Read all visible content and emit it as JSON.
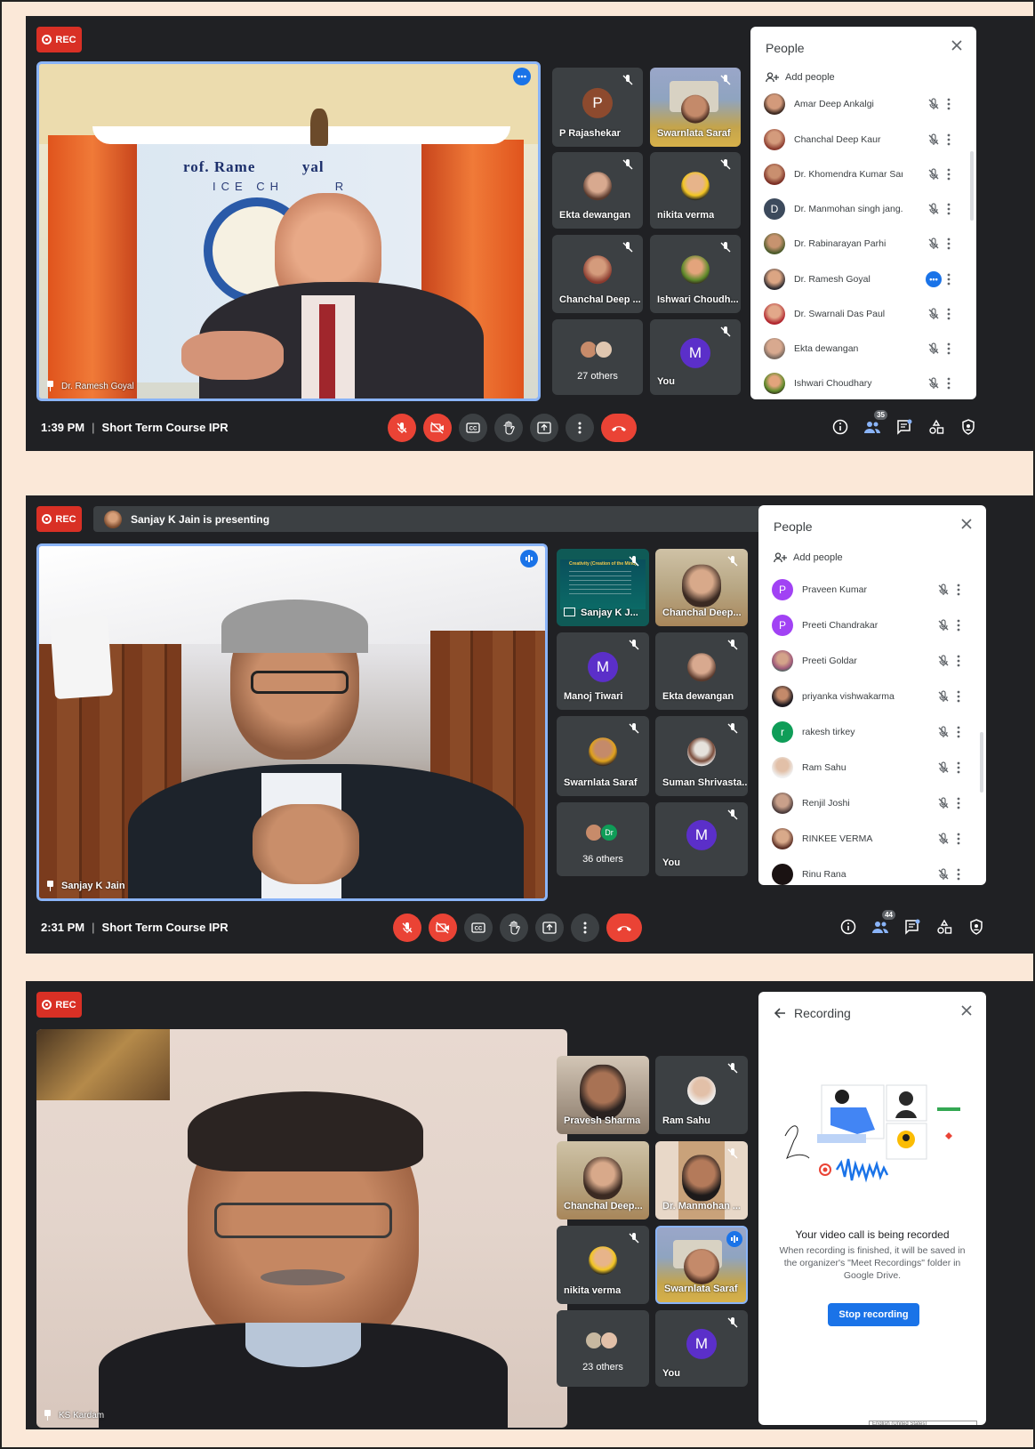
{
  "rec_label": "REC",
  "panels": [
    {
      "time": "1:39 PM",
      "meeting": "Short Term Course IPR",
      "main_name": "Dr. Ramesh Goyal",
      "tiles": [
        {
          "name": "P Rajashekar",
          "avatar": "P",
          "color": "#8d4a2e"
        },
        {
          "name": "Swarnlata Saraf"
        },
        {
          "name": "Ekta dewangan"
        },
        {
          "name": "nikita verma"
        },
        {
          "name": "Chanchal Deep ..."
        },
        {
          "name": "Ishwari Choudh..."
        },
        {
          "name": "27 others"
        },
        {
          "name": "You",
          "avatar": "M",
          "color": "#5b2fc9"
        }
      ],
      "side_title": "People",
      "add_people": "Add people",
      "people_count": "35",
      "people": [
        {
          "name": "Amar Deep Ankalgi"
        },
        {
          "name": "Chanchal Deep Kaur"
        },
        {
          "name": "Dr. Khomendra Kumar Sar..."
        },
        {
          "name": "Dr. Manmohan singh jang...",
          "avatar": "D",
          "color": "#3c4a5c"
        },
        {
          "name": "Dr. Rabinarayan Parhi"
        },
        {
          "name": "Dr. Ramesh Goyal"
        },
        {
          "name": "Dr. Swarnali Das Paul"
        },
        {
          "name": "Ekta dewangan"
        },
        {
          "name": "Ishwari Choudhary"
        }
      ]
    },
    {
      "presenting": "Sanjay K Jain is presenting",
      "time": "2:31 PM",
      "meeting": "Short Term Course IPR",
      "main_name": "Sanjay K Jain",
      "tiles": [
        {
          "name": "Sanjay K J..."
        },
        {
          "name": "Chanchal Deep..."
        },
        {
          "name": "Manoj Tiwari",
          "avatar": "M",
          "color": "#5b2fc9"
        },
        {
          "name": "Ekta dewangan"
        },
        {
          "name": "Swarnlata Saraf"
        },
        {
          "name": "Suman Shrivasta..."
        },
        {
          "name": "36 others",
          "badge": "Dr"
        },
        {
          "name": "You",
          "avatar": "M",
          "color": "#5b2fc9"
        }
      ],
      "side_title": "People",
      "add_people": "Add people",
      "people_count": "44",
      "people": [
        {
          "name": "Praveen Kumar",
          "avatar": "P",
          "color": "#a142f4"
        },
        {
          "name": "Preeti Chandrakar",
          "avatar": "P",
          "color": "#a142f4"
        },
        {
          "name": "Preeti Goldar"
        },
        {
          "name": "priyanka vishwakarma"
        },
        {
          "name": "rakesh tirkey",
          "avatar": "r",
          "color": "#0f9d58"
        },
        {
          "name": "Ram Sahu"
        },
        {
          "name": "Renjil Joshi"
        },
        {
          "name": "RINKEE VERMA"
        },
        {
          "name": "Rinu Rana"
        }
      ]
    },
    {
      "main_name": "KS Kardam",
      "tiles": [
        {
          "name": "Pravesh Sharma"
        },
        {
          "name": "Ram Sahu"
        },
        {
          "name": "Chanchal Deep..."
        },
        {
          "name": "Dr. Manmohan ..."
        },
        {
          "name": "nikita verma"
        },
        {
          "name": "Swarnlata Saraf"
        },
        {
          "name": "23 others"
        },
        {
          "name": "You",
          "avatar": "M",
          "color": "#5b2fc9"
        }
      ],
      "side_title": "Recording",
      "rec_heading": "Your video call is being recorded",
      "rec_body": "When recording is finished, it will be saved in the organizer's \"Meet Recordings\" folder in Google Drive.",
      "stop_label": "Stop recording",
      "lang": "English (United States)"
    }
  ],
  "slide_title": "Creativity (Creation of the Mind)"
}
